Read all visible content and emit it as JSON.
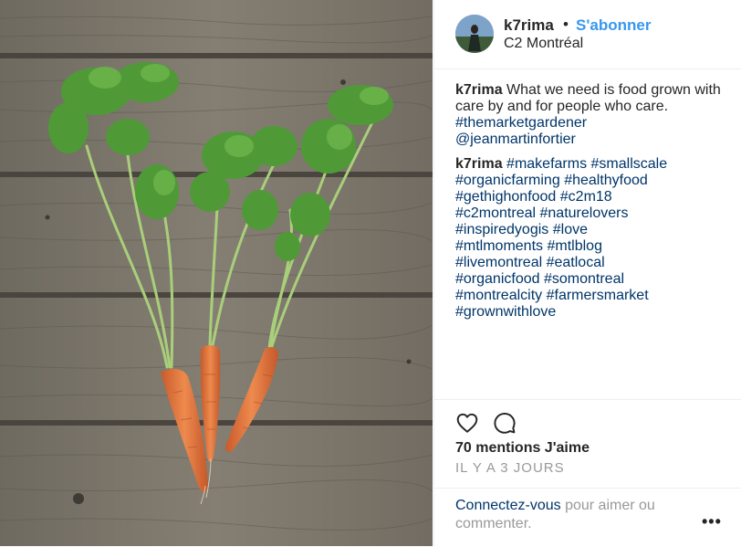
{
  "header": {
    "username": "k7rima",
    "separator": "•",
    "follow_label": "S'abonner",
    "location": "C2 Montréal"
  },
  "caption": {
    "block1": {
      "username": "k7rima",
      "text": " What we need is food grown with care by and for people who care. ",
      "tags": [
        "#themarketgardener",
        "@jeanmartinfortier"
      ]
    },
    "block2": {
      "username": "k7rima",
      "tags": [
        "#makefarms",
        "#smallscale",
        "#organicfarming",
        "#healthyfood",
        "#gethighonfood",
        "#c2m18",
        "#c2montreal",
        "#naturelovers",
        "#inspiredyogis",
        "#love",
        "#mtlmoments",
        "#mtlblog",
        "#livemontreal",
        "#eatlocal",
        "#organicfood",
        "#somontreal",
        "#montrealcity",
        "#farmersmarket",
        "#grownwithlove"
      ]
    }
  },
  "actions": {
    "heart_icon": "heart-outline-icon",
    "comment_icon": "comment-bubble-icon",
    "likes": "70 mentions J'aime",
    "time": "IL Y A 3 JOURS"
  },
  "login": {
    "link": "Connectez-vous",
    "rest": " pour aimer ou commenter.",
    "more": "•••"
  },
  "colors": {
    "link_blue": "#3897f0",
    "tag_blue": "#003569",
    "muted_gray": "#999999",
    "text": "#262626",
    "divider": "#efefef"
  }
}
